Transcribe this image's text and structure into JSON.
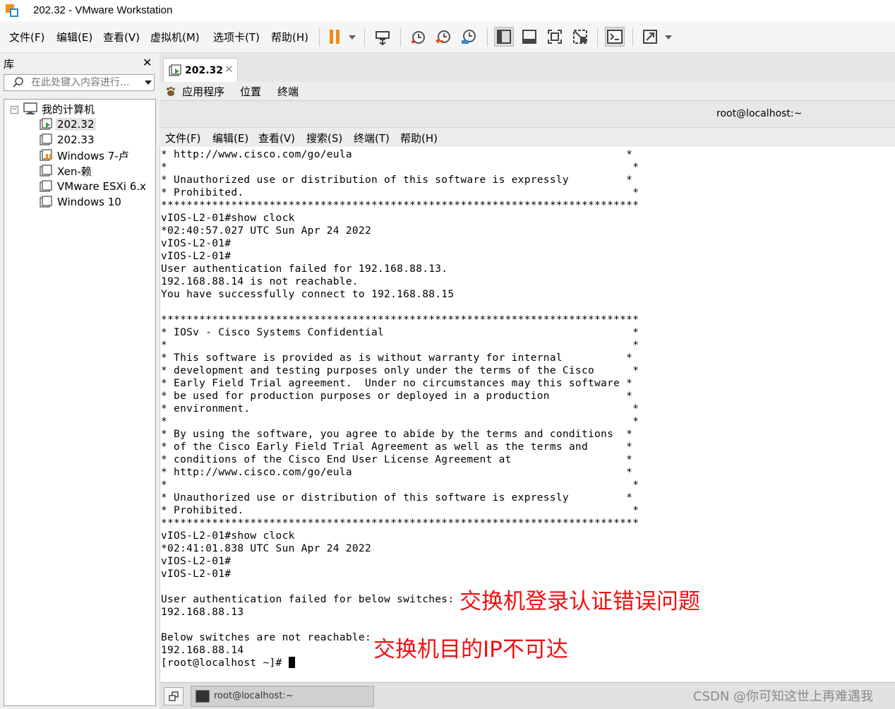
{
  "window": {
    "title": "202.32 - VMware Workstation"
  },
  "menu": {
    "items": [
      "文件(F)",
      "编辑(E)",
      "查看(V)",
      "虚拟机(M)",
      "选项卡(T)",
      "帮助(H)"
    ]
  },
  "toolbar": {
    "icons": [
      "pause-icon",
      "send-ctrl-alt-del-icon",
      "snapshot-icon",
      "revert-snapshot-icon",
      "snapshot-manager-icon",
      "show-library-icon",
      "thumbnail-bar-icon",
      "fullscreen-icon",
      "unity-icon",
      "console-view-icon",
      "stretch-icon"
    ]
  },
  "library": {
    "title": "库",
    "close_glyph": "✕",
    "search_placeholder": "在此处键入内容进行...",
    "root": "我的计算机",
    "vms": [
      "202.32",
      "202.33",
      "Windows 7-卢",
      "Xen-赖",
      "VMware ESXi 6.x",
      "Windows 10"
    ],
    "selected_vm": "202.32"
  },
  "tab": {
    "label": "202.32",
    "close_glyph": "✕"
  },
  "guest_topbar": {
    "items": [
      "应用程序",
      "位置",
      "终端"
    ]
  },
  "terminal": {
    "title": "root@localhost:~",
    "menu": [
      "文件(F)",
      "编辑(E)",
      "查看(V)",
      "搜索(S)",
      "终端(T)",
      "帮助(H)"
    ],
    "lines": [
      "* http://www.cisco.com/go/eula                                           *",
      "*                                                                         *",
      "* Unauthorized use or distribution of this software is expressly         *",
      "* Prohibited.                                                             *",
      "***************************************************************************",
      "vIOS-L2-01#show clock",
      "*02:40:57.027 UTC Sun Apr 24 2022",
      "vIOS-L2-01#",
      "vIOS-L2-01#",
      "User authentication failed for 192.168.88.13.",
      "192.168.88.14 is not reachable.",
      "You have successfully connect to 192.168.88.15",
      "",
      "***************************************************************************",
      "* IOSv - Cisco Systems Confidential                                       *",
      "*                                                                         *",
      "* This software is provided as is without warranty for internal          *",
      "* development and testing purposes only under the terms of the Cisco      *",
      "* Early Field Trial agreement.  Under no circumstances may this software *",
      "* be used for production purposes or deployed in a production            *",
      "* environment.                                                            *",
      "*                                                                         *",
      "* By using the software, you agree to abide by the terms and conditions  *",
      "* of the Cisco Early Field Trial Agreement as well as the terms and      *",
      "* conditions of the Cisco End User License Agreement at                  *",
      "* http://www.cisco.com/go/eula                                           *",
      "*                                                                         *",
      "* Unauthorized use or distribution of this software is expressly         *",
      "* Prohibited.                                                             *",
      "***************************************************************************",
      "vIOS-L2-01#show clock",
      "*02:41:01.838 UTC Sun Apr 24 2022",
      "vIOS-L2-01#",
      "vIOS-L2-01#",
      "",
      "User authentication failed for below switches:",
      "192.168.88.13",
      "",
      "Below switches are not reachable:",
      "192.168.88.14",
      "[root@localhost ~]# "
    ]
  },
  "annotations": {
    "auth_error": "交换机登录认证错误问题",
    "unreachable": "交换机目的IP不可达",
    "color": "#f01010"
  },
  "taskbar": {
    "item_label": "root@localhost:~"
  },
  "watermark": "CSDN @你可知这世上再难遇我"
}
